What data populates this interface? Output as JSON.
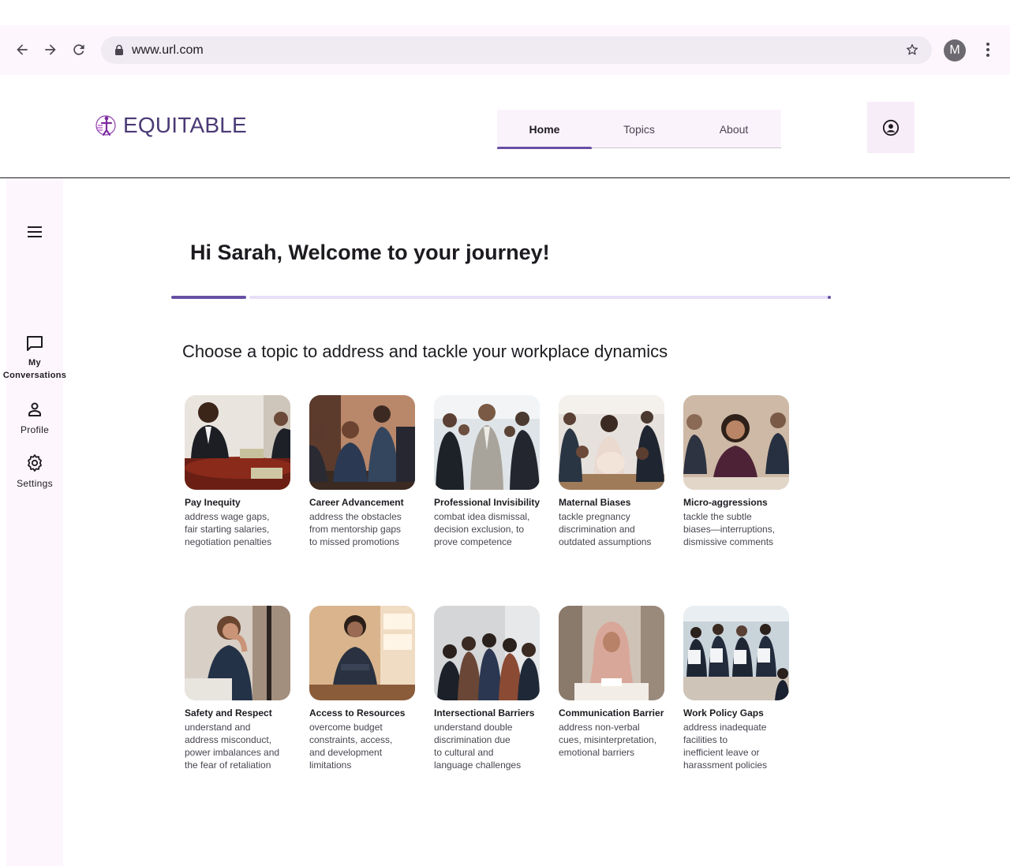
{
  "browser": {
    "url": "www.url.com",
    "profile_initial": "M"
  },
  "header": {
    "logo_text": "EQUITABLE",
    "tabs": [
      {
        "label": "Home",
        "active": true
      },
      {
        "label": "Topics",
        "active": false
      },
      {
        "label": "About",
        "active": false
      }
    ]
  },
  "rail": {
    "items": [
      {
        "label": "My\nConversations",
        "icon": "chat-icon"
      },
      {
        "label": "Profile",
        "icon": "person-icon"
      },
      {
        "label": "Settings",
        "icon": "gear-icon"
      }
    ]
  },
  "main": {
    "welcome": "Hi Sarah, Welcome to your journey!",
    "subtitle": "Choose a topic to address and tackle your workplace dynamics",
    "topics": [
      {
        "title": "Pay Inequity",
        "desc": "address wage gaps,\nfair starting salaries,\nnegotiation penalties"
      },
      {
        "title": "Career Advancement",
        "desc": "address the obstacles\nfrom mentorship gaps\nto missed promotions"
      },
      {
        "title": "Professional Invisibility",
        "desc": "combat idea dismissal,\ndecision exclusion, to\nprove competence"
      },
      {
        "title": "Maternal Biases",
        "desc": "tackle pregnancy\ndiscrimination and\noutdated assumptions"
      },
      {
        "title": "Micro-aggressions",
        "desc": "tackle the subtle\nbiases—interruptions,\ndismissive comments"
      },
      {
        "title": "Safety and Respect",
        "desc": "understand and\naddress misconduct,\npower imbalances and\nthe fear of retaliation"
      },
      {
        "title": "Access to Resources",
        "desc": "overcome budget\nconstraints, access,\nand development\nlimitations"
      },
      {
        "title": "Intersectional Barriers",
        "desc": "understand double\ndiscrimination due\nto cultural and\nlanguage challenges"
      },
      {
        "title": "Communication Barrier",
        "desc": "address non-verbal\ncues, misinterpretation,\nemotional barriers"
      },
      {
        "title": "Work Policy Gaps",
        "desc": "address inadequate\nfacilities to\ninefficient leave or\nharassment policies"
      }
    ]
  },
  "colors": {
    "accent": "#6750a4",
    "logo": "#4a3a75",
    "rail_bg": "#fdf6fd"
  }
}
